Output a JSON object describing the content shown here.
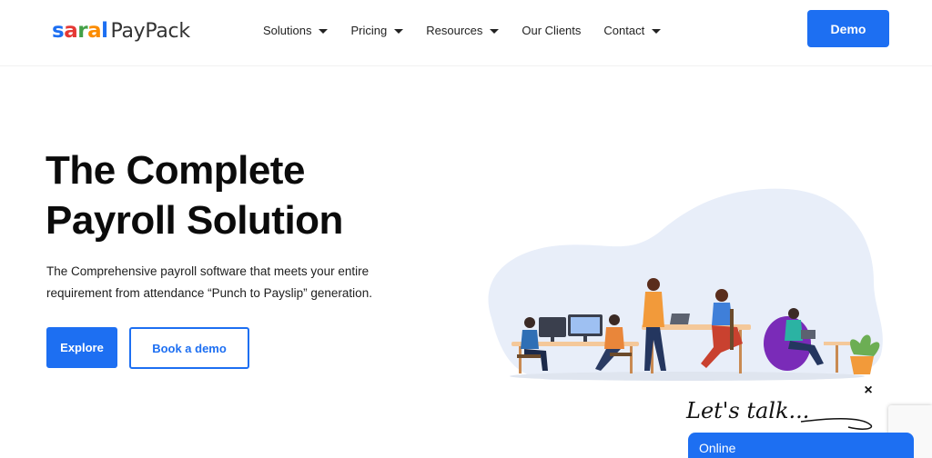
{
  "brand": {
    "saral_letters": [
      "s",
      "a",
      "r",
      "a",
      "l"
    ],
    "saral_colors": [
      "#1d6ff2",
      "#e53935",
      "#43a047",
      "#fb8c00",
      "#1d6ff2"
    ],
    "product": "PayPack"
  },
  "nav": {
    "items": [
      {
        "label": "Solutions",
        "dropdown": true
      },
      {
        "label": "Pricing",
        "dropdown": true
      },
      {
        "label": "Resources",
        "dropdown": true
      },
      {
        "label": "Our Clients",
        "dropdown": false
      },
      {
        "label": "Contact",
        "dropdown": true
      }
    ],
    "demo_label": "Demo"
  },
  "hero": {
    "title_line1": "The Complete",
    "title_line2": "Payroll Solution",
    "description": "The Comprehensive payroll software that meets your entire requirement from attendance “Punch to Payslip” generation.",
    "explore_label": "Explore",
    "book_demo_label": "Book a demo"
  },
  "chat": {
    "close_symbol": "×",
    "greeting": "Let's talk...",
    "status": "Online"
  },
  "colors": {
    "accent": "#1d6ff2"
  }
}
